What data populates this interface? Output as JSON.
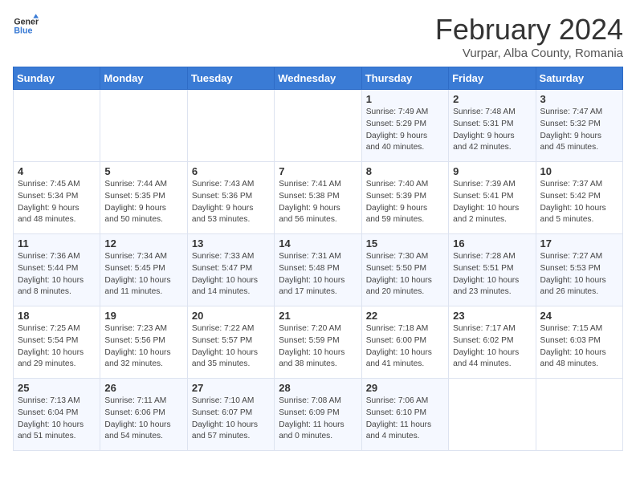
{
  "header": {
    "logo_general": "General",
    "logo_blue": "Blue",
    "month_year": "February 2024",
    "location": "Vurpar, Alba County, Romania"
  },
  "days_of_week": [
    "Sunday",
    "Monday",
    "Tuesday",
    "Wednesday",
    "Thursday",
    "Friday",
    "Saturday"
  ],
  "weeks": [
    [
      {
        "day": "",
        "content": ""
      },
      {
        "day": "",
        "content": ""
      },
      {
        "day": "",
        "content": ""
      },
      {
        "day": "",
        "content": ""
      },
      {
        "day": "1",
        "content": "Sunrise: 7:49 AM\nSunset: 5:29 PM\nDaylight: 9 hours\nand 40 minutes."
      },
      {
        "day": "2",
        "content": "Sunrise: 7:48 AM\nSunset: 5:31 PM\nDaylight: 9 hours\nand 42 minutes."
      },
      {
        "day": "3",
        "content": "Sunrise: 7:47 AM\nSunset: 5:32 PM\nDaylight: 9 hours\nand 45 minutes."
      }
    ],
    [
      {
        "day": "4",
        "content": "Sunrise: 7:45 AM\nSunset: 5:34 PM\nDaylight: 9 hours\nand 48 minutes."
      },
      {
        "day": "5",
        "content": "Sunrise: 7:44 AM\nSunset: 5:35 PM\nDaylight: 9 hours\nand 50 minutes."
      },
      {
        "day": "6",
        "content": "Sunrise: 7:43 AM\nSunset: 5:36 PM\nDaylight: 9 hours\nand 53 minutes."
      },
      {
        "day": "7",
        "content": "Sunrise: 7:41 AM\nSunset: 5:38 PM\nDaylight: 9 hours\nand 56 minutes."
      },
      {
        "day": "8",
        "content": "Sunrise: 7:40 AM\nSunset: 5:39 PM\nDaylight: 9 hours\nand 59 minutes."
      },
      {
        "day": "9",
        "content": "Sunrise: 7:39 AM\nSunset: 5:41 PM\nDaylight: 10 hours\nand 2 minutes."
      },
      {
        "day": "10",
        "content": "Sunrise: 7:37 AM\nSunset: 5:42 PM\nDaylight: 10 hours\nand 5 minutes."
      }
    ],
    [
      {
        "day": "11",
        "content": "Sunrise: 7:36 AM\nSunset: 5:44 PM\nDaylight: 10 hours\nand 8 minutes."
      },
      {
        "day": "12",
        "content": "Sunrise: 7:34 AM\nSunset: 5:45 PM\nDaylight: 10 hours\nand 11 minutes."
      },
      {
        "day": "13",
        "content": "Sunrise: 7:33 AM\nSunset: 5:47 PM\nDaylight: 10 hours\nand 14 minutes."
      },
      {
        "day": "14",
        "content": "Sunrise: 7:31 AM\nSunset: 5:48 PM\nDaylight: 10 hours\nand 17 minutes."
      },
      {
        "day": "15",
        "content": "Sunrise: 7:30 AM\nSunset: 5:50 PM\nDaylight: 10 hours\nand 20 minutes."
      },
      {
        "day": "16",
        "content": "Sunrise: 7:28 AM\nSunset: 5:51 PM\nDaylight: 10 hours\nand 23 minutes."
      },
      {
        "day": "17",
        "content": "Sunrise: 7:27 AM\nSunset: 5:53 PM\nDaylight: 10 hours\nand 26 minutes."
      }
    ],
    [
      {
        "day": "18",
        "content": "Sunrise: 7:25 AM\nSunset: 5:54 PM\nDaylight: 10 hours\nand 29 minutes."
      },
      {
        "day": "19",
        "content": "Sunrise: 7:23 AM\nSunset: 5:56 PM\nDaylight: 10 hours\nand 32 minutes."
      },
      {
        "day": "20",
        "content": "Sunrise: 7:22 AM\nSunset: 5:57 PM\nDaylight: 10 hours\nand 35 minutes."
      },
      {
        "day": "21",
        "content": "Sunrise: 7:20 AM\nSunset: 5:59 PM\nDaylight: 10 hours\nand 38 minutes."
      },
      {
        "day": "22",
        "content": "Sunrise: 7:18 AM\nSunset: 6:00 PM\nDaylight: 10 hours\nand 41 minutes."
      },
      {
        "day": "23",
        "content": "Sunrise: 7:17 AM\nSunset: 6:02 PM\nDaylight: 10 hours\nand 44 minutes."
      },
      {
        "day": "24",
        "content": "Sunrise: 7:15 AM\nSunset: 6:03 PM\nDaylight: 10 hours\nand 48 minutes."
      }
    ],
    [
      {
        "day": "25",
        "content": "Sunrise: 7:13 AM\nSunset: 6:04 PM\nDaylight: 10 hours\nand 51 minutes."
      },
      {
        "day": "26",
        "content": "Sunrise: 7:11 AM\nSunset: 6:06 PM\nDaylight: 10 hours\nand 54 minutes."
      },
      {
        "day": "27",
        "content": "Sunrise: 7:10 AM\nSunset: 6:07 PM\nDaylight: 10 hours\nand 57 minutes."
      },
      {
        "day": "28",
        "content": "Sunrise: 7:08 AM\nSunset: 6:09 PM\nDaylight: 11 hours\nand 0 minutes."
      },
      {
        "day": "29",
        "content": "Sunrise: 7:06 AM\nSunset: 6:10 PM\nDaylight: 11 hours\nand 4 minutes."
      },
      {
        "day": "",
        "content": ""
      },
      {
        "day": "",
        "content": ""
      }
    ]
  ]
}
